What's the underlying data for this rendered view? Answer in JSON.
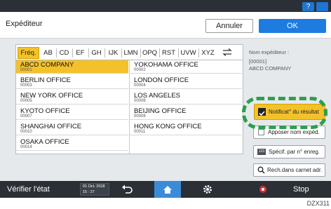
{
  "top_bar": {
    "help_label": "?",
    "moon_icon": "moon-icon"
  },
  "header": {
    "title": "Expéditeur",
    "cancel_label": "Annuler",
    "ok_label": "OK"
  },
  "tabs": [
    "Fréq.",
    "AB",
    "CD",
    "EF",
    "GH",
    "IJK",
    "LMN",
    "OPQ",
    "RST",
    "UVW",
    "XYZ"
  ],
  "tabs_selected": "Fréq.",
  "rows_left": [
    {
      "name": "ABCD COMPANY",
      "num": "00001",
      "selected": true
    },
    {
      "name": "BERLIN OFFICE",
      "num": "00003"
    },
    {
      "name": "NEW YORK OFFICE",
      "num": "00005"
    },
    {
      "name": "KYOTO OFFICE",
      "num": "00007"
    },
    {
      "name": "SHANGHAI  OFFICE",
      "num": "00010"
    },
    {
      "name": "OSAKA OFFICE",
      "num": "00014"
    }
  ],
  "rows_right": [
    {
      "name": "YOKOHAMA OFFICE",
      "num": "00002"
    },
    {
      "name": "LONDON OFFICE",
      "num": "00004"
    },
    {
      "name": "LOS ANGELES",
      "num": "00006"
    },
    {
      "name": "BEIJING OFFICE",
      "num": "00008"
    },
    {
      "name": "HONG KONG OFFICE",
      "num": "00011"
    }
  ],
  "right_panel": {
    "sender_label": "Nom expéditeur :",
    "sender_id": "[00001]",
    "sender_name": "ABCD COMPANY",
    "notify_label": "Notificat° du résultat",
    "stamp_label": "Apposer nom expéd.",
    "reg_label": "Spécif. par n° enreg.",
    "search_label": "Rech.dans carnet adr."
  },
  "bottom_bar": {
    "check_status": "Vérifier l'état",
    "date": "01 Oct. 2018",
    "time": "15 : 27",
    "stop": "Stop"
  },
  "footer_code": "DZX311",
  "colors": {
    "accent": "#1e7be0",
    "selected": "#f3c22b",
    "dashed_highlight": "#2e9e4f",
    "stop_red": "#e03030"
  }
}
